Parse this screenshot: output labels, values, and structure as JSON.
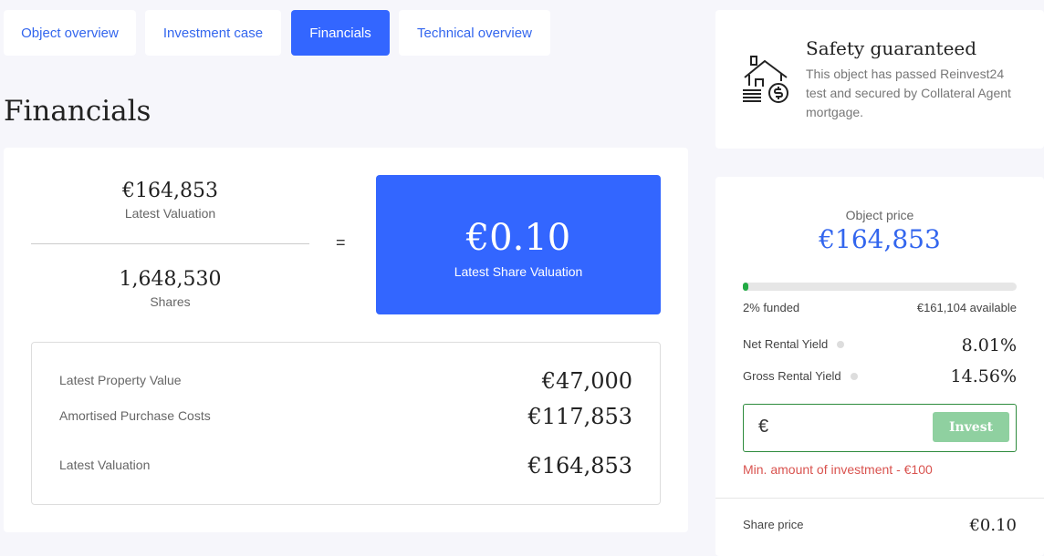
{
  "tabs": [
    {
      "label": "Object overview"
    },
    {
      "label": "Investment case"
    },
    {
      "label": "Financials"
    },
    {
      "label": "Technical overview"
    }
  ],
  "page_title": "Financials",
  "financials": {
    "latest_valuation_value": "€164,853",
    "latest_valuation_label": "Latest Valuation",
    "shares_value": "1,648,530",
    "shares_label": "Shares",
    "equals": "=",
    "share_valuation_value": "€0.10",
    "share_valuation_label": "Latest Share Valuation",
    "breakdown": [
      {
        "label": "Latest Property Value",
        "value": "€47,000"
      },
      {
        "label": "Amortised Purchase Costs",
        "value": "€117,853"
      },
      {
        "label": "Latest Valuation",
        "value": "€164,853"
      }
    ]
  },
  "safety": {
    "title": "Safety guaranteed",
    "text": "This object has passed Reinvest24 test and secured by Collateral Agent mortgage."
  },
  "invest": {
    "object_price_label": "Object price",
    "object_price_value": "€164,853",
    "funded_fraction": 0.02,
    "funded_text": "2% funded",
    "available_text": "€161,104 available",
    "net_yield_label": "Net Rental Yield",
    "net_yield_value": "8.01%",
    "gross_yield_label": "Gross Rental Yield",
    "gross_yield_value": "14.56%",
    "currency_symbol": "€",
    "amount_placeholder": "",
    "invest_button": "Invest",
    "min_note": "Min. amount of investment - €100",
    "share_price_label": "Share price",
    "share_price_value": "€0.10"
  },
  "colors": {
    "accent": "#3366ff",
    "success": "#22aa44",
    "error": "#d9534f"
  }
}
